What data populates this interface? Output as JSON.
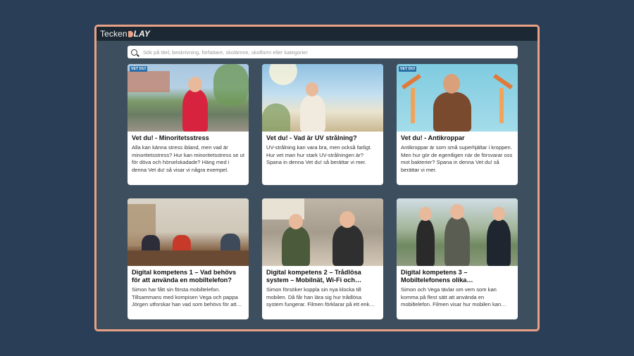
{
  "app": {
    "logo_part1": "Tecken",
    "logo_part2": "LAY"
  },
  "search": {
    "placeholder": "Sök på titel, beskrivning, författare, skolämne, skolform eller kategorier"
  },
  "cards": [
    {
      "badge": "VET DU!",
      "title": "Vet du! - Minoritetsstress",
      "description": "Alla kan känna stress ibland, men vad är minoritetsstress? Hur kan minoritetsstress se ut för döva och hörselskadade? Häng med i denna Vet du! så visar vi några exempel."
    },
    {
      "badge": "",
      "title": "Vet du! - Vad är UV strålning?",
      "description": "UV-strålning kan vara bra, men också farligt. Hur vet man hur stark UV-strålningen är? Spana in denna Vet du! så berättar vi mer."
    },
    {
      "badge": "VET DU!",
      "title": "Vet du! - Antikroppar",
      "description": "Antikroppar är som små superhjältar i kroppen. Men hur gör de egentligen när de försvarar oss mot bakterier? Spana in denna Vet du! så berättar vi mer."
    },
    {
      "badge": "",
      "title": "Digital kompetens 1 – Vad behövs för att använda en mobiltelefon?",
      "description": "Simon har fått sin första mobiltelefon. Tillsammans med kompisen Vega och pappa Jörgen utforskar han vad som behövs för att…"
    },
    {
      "badge": "",
      "title": "Digital kompetens 2 – Trådlösa system – Mobilnät, Wi-Fi och…",
      "description": "Simon försöker koppla sin nya klocka till mobilen. Då får han lära sig hur trådlösa system fungerar. Filmen förklarar på ett enk…"
    },
    {
      "badge": "",
      "title": "Digital kompetens 3 – Mobiltelefonens olika…",
      "description": "Simon och Vega tävlar om vem som kan komma på flest sätt att använda en mobiltelefon. Filmen visar hur mobilen kan…"
    }
  ]
}
